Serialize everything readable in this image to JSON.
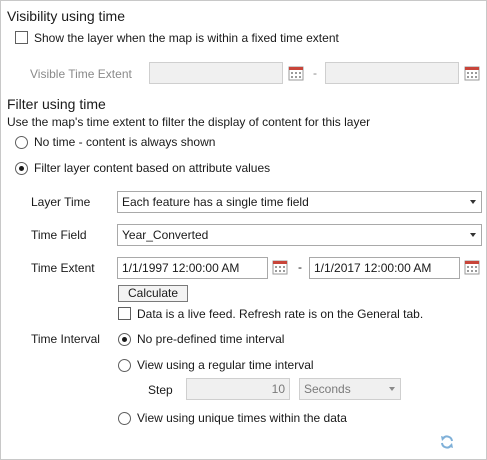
{
  "visibility": {
    "heading": "Visibility using time",
    "checkbox_label": "Show the layer when the map is within a fixed time extent",
    "visible_time_extent_label": "Visible Time Extent",
    "start_value": "",
    "end_value": "",
    "dash": "-"
  },
  "filter": {
    "heading": "Filter using time",
    "description": "Use the map's time extent to filter the display of content for this layer",
    "radio_no_time": "No time - content is always shown",
    "radio_attribute": "Filter layer content based on attribute values",
    "layer_time_label": "Layer Time",
    "layer_time_value": "Each feature has a single time field",
    "time_field_label": "Time Field",
    "time_field_value": "Year_Converted",
    "time_extent_label": "Time Extent",
    "time_extent_start": "1/1/1997 12:00:00 AM",
    "time_extent_end": "1/1/2017 12:00:00 AM",
    "dash": "-",
    "calculate_button": "Calculate",
    "live_feed_label": "Data is a live feed. Refresh rate is on the General tab.",
    "time_interval_label": "Time Interval",
    "interval_none": "No pre-defined time interval",
    "interval_regular": "View using a regular time interval",
    "step_label": "Step",
    "step_value": "10",
    "step_unit": "Seconds",
    "interval_unique": "View using unique times within the data"
  },
  "icons": {
    "calendar": "calendar-icon",
    "refresh": "refresh-icon"
  },
  "colors": {
    "refresh_icon": "#7fb0d8",
    "calendar_header": "#c8453a"
  }
}
